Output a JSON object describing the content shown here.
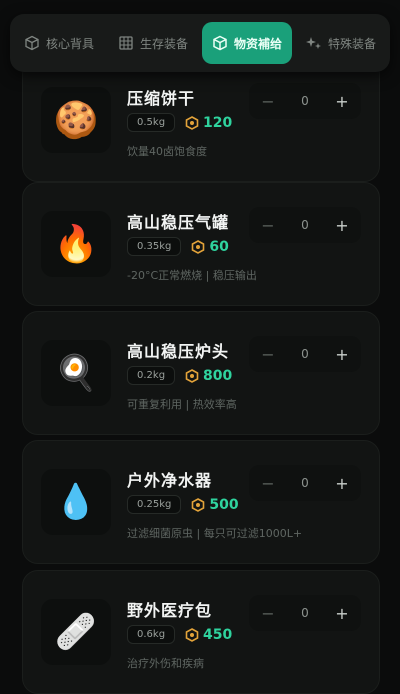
{
  "tabs": [
    {
      "label": "核心背具",
      "icon": "cube-icon",
      "active": false
    },
    {
      "label": "生存装备",
      "icon": "grid-icon",
      "active": false
    },
    {
      "label": "物资補给",
      "icon": "box-icon",
      "active": true
    },
    {
      "label": "特殊装备",
      "icon": "sparkle-icon",
      "active": false
    }
  ],
  "items": [
    {
      "name": "压缩饼干",
      "weight": "0.5kg",
      "price": "120",
      "desc": "饮量40卤饱食度",
      "qty": "0",
      "icon": "cookie-icon",
      "emoji": "🍪"
    },
    {
      "name": "高山稳压气罐",
      "weight": "0.35kg",
      "price": "60",
      "desc": "-20°C正常燃烧 | 稳压输出",
      "qty": "0",
      "icon": "flame-icon",
      "emoji": "🔥"
    },
    {
      "name": "高山稳压炉头",
      "weight": "0.2kg",
      "price": "800",
      "desc": "可重复利用 | 热效率高",
      "qty": "0",
      "icon": "frying-pan-icon",
      "emoji": "🍳"
    },
    {
      "name": "户外净水器",
      "weight": "0.25kg",
      "price": "500",
      "desc": "过滤细菌原虫 | 每只可过滤1000L+",
      "qty": "0",
      "icon": "water-drop-icon",
      "emoji": "💧"
    },
    {
      "name": "野外医疗包",
      "weight": "0.6kg",
      "price": "450",
      "desc": "治疗外伤和疾病",
      "qty": "0",
      "icon": "bandage-icon",
      "emoji": "🩹"
    }
  ],
  "stepper": {
    "minus": "−",
    "plus": "+"
  },
  "colors": {
    "accent": "#1aa07a",
    "price": "#2fd39e",
    "coin": "#e3a33a",
    "background": "#0b0c0c"
  }
}
